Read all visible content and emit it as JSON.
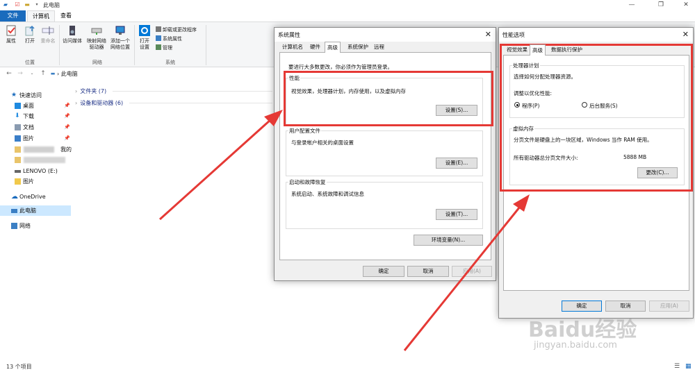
{
  "explorer": {
    "title": "此电脑",
    "tabs": {
      "file": "文件",
      "computer": "计算机",
      "view": "查看"
    },
    "ribbon": {
      "properties": "属性",
      "open": "打开",
      "rename": "重命名",
      "location_group": "位置",
      "access_media": "访问媒体",
      "map_drive_1": "映射网络",
      "map_drive_2": "驱动器",
      "add_loc_1": "添加一个",
      "add_loc_2": "网络位置",
      "network_group": "网络",
      "open_settings_1": "打开",
      "open_settings_2": "设置",
      "uninstall": "卸载或更改程序",
      "system_props": "系统属性",
      "manage": "管理",
      "system_group": "系统"
    },
    "address_path": "此电脑",
    "sidebar": {
      "quick_access": "快速访问",
      "desktop": "桌面",
      "downloads": "下载",
      "documents": "文档",
      "pictures": "图片",
      "blurred_suffix": "我的",
      "lenovo": "LENOVO (E:)",
      "pictures2": "图片",
      "onedrive": "OneDrive",
      "this_pc": "此电脑",
      "network": "网络"
    },
    "groups": {
      "folders": "文件夹 (7)",
      "devices": "设备和驱动器 (6)"
    },
    "status": "13 个项目",
    "window_controls": {
      "minimize": "—",
      "restore": "❐",
      "close": "✕"
    }
  },
  "sysprops": {
    "title": "系统属性",
    "tabs": [
      "计算机名",
      "硬件",
      "高级",
      "系统保护",
      "远程"
    ],
    "admin_note": "要进行大多数更改，你必须作为管理员登录。",
    "perf_title": "性能",
    "perf_desc": "视觉效果，处理器计划，内存使用，以及虚拟内存",
    "settings_btn": "设置(S)...",
    "profile_title": "用户配置文件",
    "profile_desc": "与登录帐户相关的桌面设置",
    "settings_e_btn": "设置(E)...",
    "startup_title": "启动和故障恢复",
    "startup_desc": "系统启动、系统故障和调试信息",
    "settings_t_btn": "设置(T)...",
    "env_btn": "环境变量(N)...",
    "ok": "确定",
    "cancel": "取消",
    "apply": "应用(A)"
  },
  "perfopts": {
    "title": "性能选项",
    "tabs": [
      "视觉效果",
      "高级",
      "数据执行保护"
    ],
    "cpu_title": "处理器计划",
    "cpu_desc": "选择如何分配处理器资源。",
    "adjust_label": "调整以优化性能:",
    "programs": "程序(P)",
    "background": "后台服务(S)",
    "vm_title": "虚拟内存",
    "vm_desc": "分页文件是硬盘上的一块区域，Windows 当作 RAM 使用。",
    "vm_total_label": "所有驱动器总分页文件大小:",
    "vm_total_value": "5888 MB",
    "change_btn": "更改(C)...",
    "ok": "确定",
    "cancel": "取消",
    "apply": "应用(A)"
  },
  "watermark": {
    "logo": "Baidu经验",
    "url": "jingyan.baidu.com"
  },
  "colors": {
    "highlight": "#e53935",
    "accent": "#0078d7",
    "file_tab": "#1a6bbd"
  }
}
